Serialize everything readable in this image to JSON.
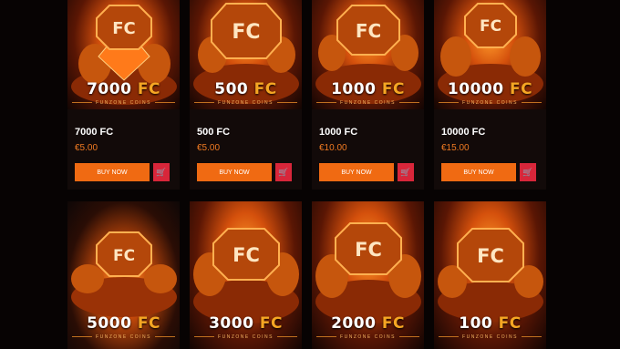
{
  "colors": {
    "background": "#070303",
    "card": "#120a09",
    "accent": "#f06a12",
    "price": "#f07a22",
    "cart": "#d8263a",
    "unit": "#f5a623"
  },
  "brand_tagline": "FUNZONE COINS",
  "unit_label": "FC",
  "buy_label": "BUY NOW",
  "cart_icon": "cart-icon",
  "products_row1": [
    {
      "amount": "7000",
      "name": "7000 FC",
      "price": "€5.00"
    },
    {
      "amount": "500",
      "name": "500 FC",
      "price": "€5.00"
    },
    {
      "amount": "1000",
      "name": "1000 FC",
      "price": "€10.00"
    },
    {
      "amount": "10000",
      "name": "10000 FC",
      "price": "€15.00"
    }
  ],
  "products_row2": [
    {
      "amount": "5000"
    },
    {
      "amount": "3000"
    },
    {
      "amount": "2000"
    },
    {
      "amount": "100"
    }
  ]
}
